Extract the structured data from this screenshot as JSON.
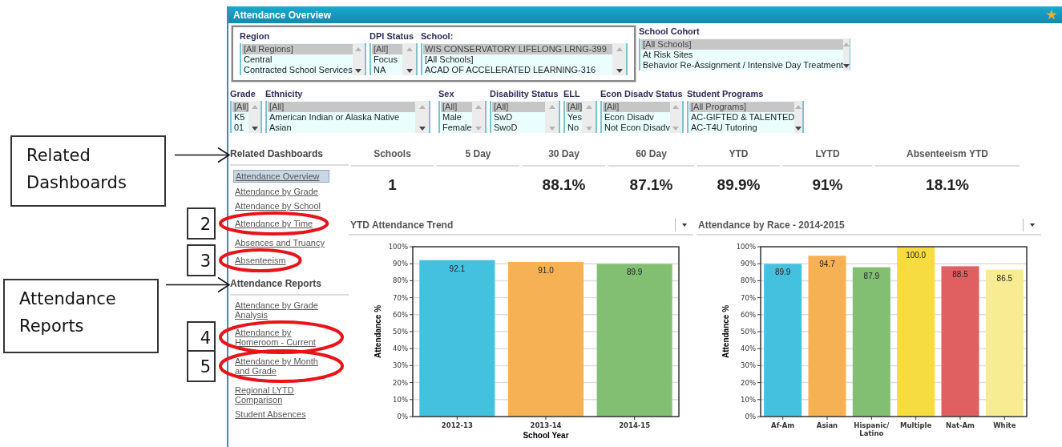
{
  "annotations": [
    {
      "kind": "callout",
      "text": "Related Dashboards"
    },
    {
      "kind": "arrow"
    },
    {
      "kind": "callout",
      "text": "Attendance Reports"
    },
    {
      "kind": "arrow"
    },
    {
      "kind": "number",
      "text": "2"
    },
    {
      "kind": "number",
      "text": "3"
    },
    {
      "kind": "number",
      "text": "4"
    },
    {
      "kind": "number",
      "text": "5"
    },
    {
      "kind": "ring"
    },
    {
      "kind": "ring"
    },
    {
      "kind": "ring"
    },
    {
      "kind": "ring"
    }
  ],
  "header": {
    "title": "Attendance Overview",
    "favorite": true
  },
  "filter_group": [
    {
      "label": "Region",
      "scrollable": true,
      "options": [
        {
          "text": "[All Regions]",
          "selected": true
        },
        {
          "text": "Central",
          "selected": false
        },
        {
          "text": "Contracted School Services",
          "selected": false
        }
      ]
    },
    {
      "label": "DPI Status",
      "scrollable": true,
      "options": [
        {
          "text": "[All]",
          "selected": true
        },
        {
          "text": "Focus",
          "selected": false
        },
        {
          "text": "NA",
          "selected": false
        }
      ]
    },
    {
      "label": "School:",
      "scrollable": true,
      "options": [
        {
          "text": "WIS CONSERVATORY LIFELONG LRNG-399",
          "selected": true
        },
        {
          "text": "[All Schools]",
          "selected": false
        },
        {
          "text": "ACAD OF ACCELERATED LEARNING-316",
          "selected": false
        }
      ]
    }
  ],
  "school_cohort": {
    "label": "School Cohort",
    "scrollable": true,
    "options": [
      {
        "text": "[All Schools]",
        "selected": true
      },
      {
        "text": "At Risk Sites",
        "selected": false
      },
      {
        "text": "Behavior Re-Assignment / Intensive Day Treatment",
        "selected": false
      }
    ]
  },
  "filters": [
    {
      "label": "Grade",
      "scrollable": true,
      "options": [
        {
          "text": "[All]",
          "selected": true
        },
        {
          "text": "K5",
          "selected": false
        },
        {
          "text": "01",
          "selected": false
        }
      ]
    },
    {
      "label": "Ethnicity",
      "scrollable": true,
      "options": [
        {
          "text": "[All]",
          "selected": true
        },
        {
          "text": "American Indian or Alaska Native",
          "selected": false
        },
        {
          "text": "Asian",
          "selected": false
        }
      ]
    },
    {
      "label": "Sex",
      "scrollable": false,
      "options": [
        {
          "text": "[All]",
          "selected": true
        },
        {
          "text": "Male",
          "selected": false
        },
        {
          "text": "Female",
          "selected": false
        }
      ]
    },
    {
      "label": "Disability Status",
      "scrollable": false,
      "options": [
        {
          "text": "[All]",
          "selected": true
        },
        {
          "text": "SwD",
          "selected": false
        },
        {
          "text": "SwoD",
          "selected": false
        }
      ]
    },
    {
      "label": "ELL",
      "scrollable": false,
      "options": [
        {
          "text": "[All]",
          "selected": true
        },
        {
          "text": "Yes",
          "selected": false
        },
        {
          "text": "No",
          "selected": false
        }
      ]
    },
    {
      "label": "Econ Disadv Status",
      "scrollable": false,
      "options": [
        {
          "text": "[All]",
          "selected": true
        },
        {
          "text": "Econ Disadv",
          "selected": false
        },
        {
          "text": "Not Econ Disadv",
          "selected": false
        }
      ]
    },
    {
      "label": "Student Programs",
      "scrollable": true,
      "options": [
        {
          "text": "[All Programs]",
          "selected": true
        },
        {
          "text": "AC-GIFTED & TALENTED",
          "selected": false
        },
        {
          "text": "AC-T4U Tutoring",
          "selected": false
        }
      ]
    }
  ],
  "sidebar": [
    {
      "heading": "Related Dashboards",
      "links": [
        {
          "text": "Attendance Overview",
          "selected": true
        },
        {
          "text": "Attendance by Grade",
          "selected": false
        },
        {
          "text": "Attendance by School",
          "selected": false
        },
        {
          "text": "Attendance by Time",
          "selected": false
        },
        {
          "text": "Absences and Truancy",
          "selected": false
        },
        {
          "text": "Absenteeism",
          "selected": false
        }
      ]
    },
    {
      "heading": "Attendance Reports",
      "links": [
        {
          "text": "Attendance by Grade Analysis",
          "selected": false
        },
        {
          "text": "Attendance by Homeroom - Current",
          "selected": false
        },
        {
          "text": "Attendance by Month and Grade",
          "selected": false
        },
        {
          "text": "Regional LYTD Comparison",
          "selected": false
        },
        {
          "text": "Student Absences",
          "selected": false
        }
      ]
    }
  ],
  "kpis": [
    {
      "label": "Schools",
      "value": "1"
    },
    {
      "label": "5 Day"
    },
    {
      "label": "30 Day",
      "value": "88.1%"
    },
    {
      "label": "60 Day",
      "value": "87.1%"
    },
    {
      "label": "YTD",
      "value": "89.9%"
    },
    {
      "label": "LYTD",
      "value": "91%"
    },
    {
      "label": "Absenteeism YTD",
      "value": "18.1%"
    }
  ],
  "charts": [
    {
      "title": "YTD Attendance Trend",
      "bar_styles": [
        {
          "color": "#45c1e0"
        },
        {
          "color": "#f7b155"
        },
        {
          "color": "#82bf73"
        }
      ],
      "chart_data": {
        "type": "bar",
        "xlabel": "School Year",
        "ylabel": "Attendance %",
        "categories": [
          "2012-13",
          "2013-14",
          "2014-15"
        ],
        "values": [
          92.1,
          91.0,
          89.9
        ],
        "value_labels": [
          "92.1",
          "91.0",
          "89.9"
        ],
        "grid": true,
        "ylim": [
          0,
          100
        ],
        "yticks": [
          {
            "value": 0,
            "label": "0%"
          },
          {
            "value": 10,
            "label": "10%"
          },
          {
            "value": 20,
            "label": "20%"
          },
          {
            "value": 30,
            "label": "30%"
          },
          {
            "value": 40,
            "label": "40%"
          },
          {
            "value": 50,
            "label": "50%"
          },
          {
            "value": 60,
            "label": "60%"
          },
          {
            "value": 70,
            "label": "70%"
          },
          {
            "value": 80,
            "label": "80%"
          },
          {
            "value": 90,
            "label": "90%"
          },
          {
            "value": 100,
            "label": "100%"
          }
        ],
        "data_labels": true
      }
    },
    {
      "title": "Attendance by Race - 2014-2015",
      "bar_styles": [
        {
          "color": "#45c1e0"
        },
        {
          "color": "#f7b155"
        },
        {
          "color": "#82bf73"
        },
        {
          "color": "#f6dc40"
        },
        {
          "color": "#e06062"
        },
        {
          "color": "#f8ec92"
        }
      ],
      "chart_data": {
        "type": "bar",
        "ylabel": "Attendance %",
        "categories": [
          "Af-Am",
          "Asian",
          "Hispanic/ Latino",
          "Multiple",
          "Nat-Am",
          "White"
        ],
        "values": [
          89.9,
          94.7,
          87.9,
          100.0,
          88.5,
          86.5
        ],
        "value_labels": [
          "89.9",
          "94.7",
          "87.9",
          "100.0",
          "88.5",
          "86.5"
        ],
        "grid": true,
        "ylim": [
          0,
          100
        ],
        "yticks": [
          {
            "value": 0,
            "label": "0%"
          },
          {
            "value": 10,
            "label": "10%"
          },
          {
            "value": 20,
            "label": "20%"
          },
          {
            "value": 30,
            "label": "30%"
          },
          {
            "value": 40,
            "label": "40%"
          },
          {
            "value": 50,
            "label": "50%"
          },
          {
            "value": 60,
            "label": "60%"
          },
          {
            "value": 70,
            "label": "70%"
          },
          {
            "value": 80,
            "label": "80%"
          },
          {
            "value": 90,
            "label": "90%"
          },
          {
            "value": 100,
            "label": "100%"
          }
        ],
        "data_labels": true
      }
    }
  ]
}
